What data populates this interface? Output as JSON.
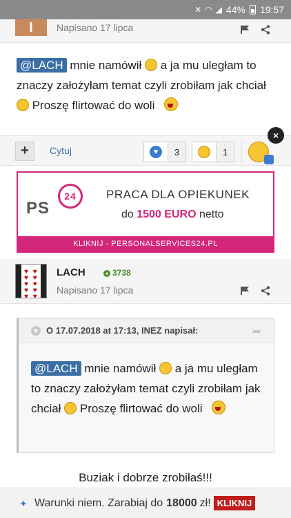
{
  "status_bar": {
    "battery": "44%",
    "time": "19:57"
  },
  "post1": {
    "avatar_letter": "I",
    "date": "Napisano 17 lipca",
    "mention": "@LACH",
    "text_a": " mnie namówił ",
    "text_b": "  a ja mu uległam to znaczy założyłam temat czyli zrobiłam jak chciał ",
    "text_c": " Proszę flirtować do woli "
  },
  "actions": {
    "plus_label": "+",
    "quote_label": "Cytuj",
    "reaction_like_count": "3",
    "reaction_haha_count": "1",
    "close_label": "×"
  },
  "ad": {
    "logo_text": "PS",
    "logo_num": "24",
    "line1": "PRACA DLA OPIEKUNEK",
    "line2_pre": "do ",
    "line2_highlight": "1500 EURO",
    "line2_post": " netto",
    "bar": "KLIKNIJ - PERSONALSERVICES24.PL"
  },
  "post2": {
    "username": "LACH",
    "reputation": "3738",
    "date": "Napisano 17 lipca",
    "quote_title": "O 17.07.2018 at 17:13, INEZ napisał:",
    "quote_mention": "@LACH",
    "quote_text_a": " mnie namówił ",
    "quote_text_b": "  a ja mu uległam to znaczy założyłam temat czyli zrobiłam jak chciał ",
    "quote_text_c": " Proszę flirtować do woli ",
    "reply": "Buziak i dobrze zrobiłaś!!!"
  },
  "bottom_ad": {
    "text": "Warunki niem. Zarabiaj do",
    "amount": "18000",
    "currency": "zł!",
    "cta": "KLIKNIJ"
  },
  "colors": {
    "accent": "#3a6ea5",
    "ad_pink": "#d4267a",
    "rep_green": "#4a8c2a",
    "cta_red": "#c21d1d"
  }
}
